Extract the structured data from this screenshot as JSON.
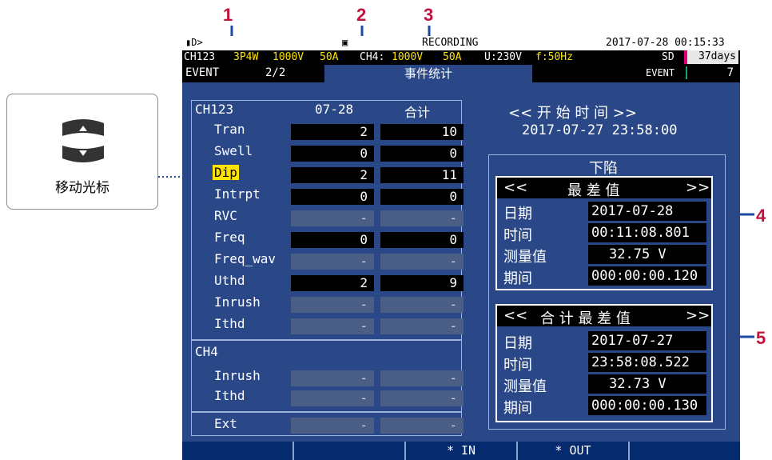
{
  "callouts": [
    "1",
    "2",
    "3",
    "4",
    "5"
  ],
  "side": {
    "label": "移动光标",
    "icon": "cursor-updown-icon"
  },
  "header": {
    "status_right": "2017-07-28  00:15:33",
    "recording": "RECORDING",
    "line2": [
      "CH123",
      "3P4W",
      "1000V",
      "50A",
      "CH4:",
      "1000V",
      "50A",
      "U:230V",
      "f:50Hz"
    ],
    "sd": "SD",
    "days": "37days",
    "page_left": "EVENT",
    "page": "2/2",
    "tab": "事件统计",
    "event_label": "EVENT",
    "event_count": "7"
  },
  "table": {
    "group1": "CH123",
    "col_date": "07-28",
    "col_total": "合计",
    "rows": [
      {
        "label": "Tran",
        "day": "2",
        "total": "10",
        "on": true
      },
      {
        "label": "Swell",
        "day": "0",
        "total": "0",
        "on": true
      },
      {
        "label": "Dip",
        "day": "2",
        "total": "11",
        "on": true,
        "selected": true
      },
      {
        "label": "Intrpt",
        "day": "0",
        "total": "0",
        "on": true
      },
      {
        "label": "RVC",
        "day": "-",
        "total": "-",
        "on": false
      },
      {
        "label": "Freq",
        "day": "0",
        "total": "0",
        "on": true
      },
      {
        "label": "Freq_wav",
        "day": "-",
        "total": "-",
        "on": false
      },
      {
        "label": "Uthd",
        "day": "2",
        "total": "9",
        "on": true
      },
      {
        "label": "Inrush",
        "day": "-",
        "total": "-",
        "on": false
      },
      {
        "label": "Ithd",
        "day": "-",
        "total": "-",
        "on": false
      }
    ],
    "group2": "CH4",
    "rows_ch4": [
      {
        "label": "Inrush",
        "day": "-",
        "total": "-"
      },
      {
        "label": "Ithd",
        "day": "-",
        "total": "-"
      }
    ],
    "ext": {
      "label": "Ext",
      "day": "-",
      "total": "-"
    }
  },
  "right": {
    "start_title": "<<  开 始 时 间  >>",
    "start_time": "2017-07-27 23:58:00",
    "section": "下陷",
    "worst": {
      "title_left": "<<",
      "title": "最 差 值",
      "title_right": ">>",
      "date_label": "日期",
      "date": "2017-07-28",
      "time_label": "时间",
      "time": "00:11:08.801",
      "value_label": "测量值",
      "value": "32.75 V",
      "dur_label": "期间",
      "duration": "000:00:00.120"
    },
    "total_worst": {
      "title_left": "<<",
      "title": "合 计 最 差 值",
      "title_right": ">>",
      "date_label": "日期",
      "date": "2017-07-27",
      "time_label": "时间",
      "time": "23:58:08.522",
      "value_label": "测量值",
      "value": "32.73 V",
      "dur_label": "期间",
      "duration": "000:00:00.130"
    }
  },
  "fkeys": [
    "",
    "",
    "* IN",
    "* OUT",
    ""
  ],
  "colors": {
    "screen": "#2a4887",
    "callout": "#c0143c",
    "select": "#ffe400"
  }
}
